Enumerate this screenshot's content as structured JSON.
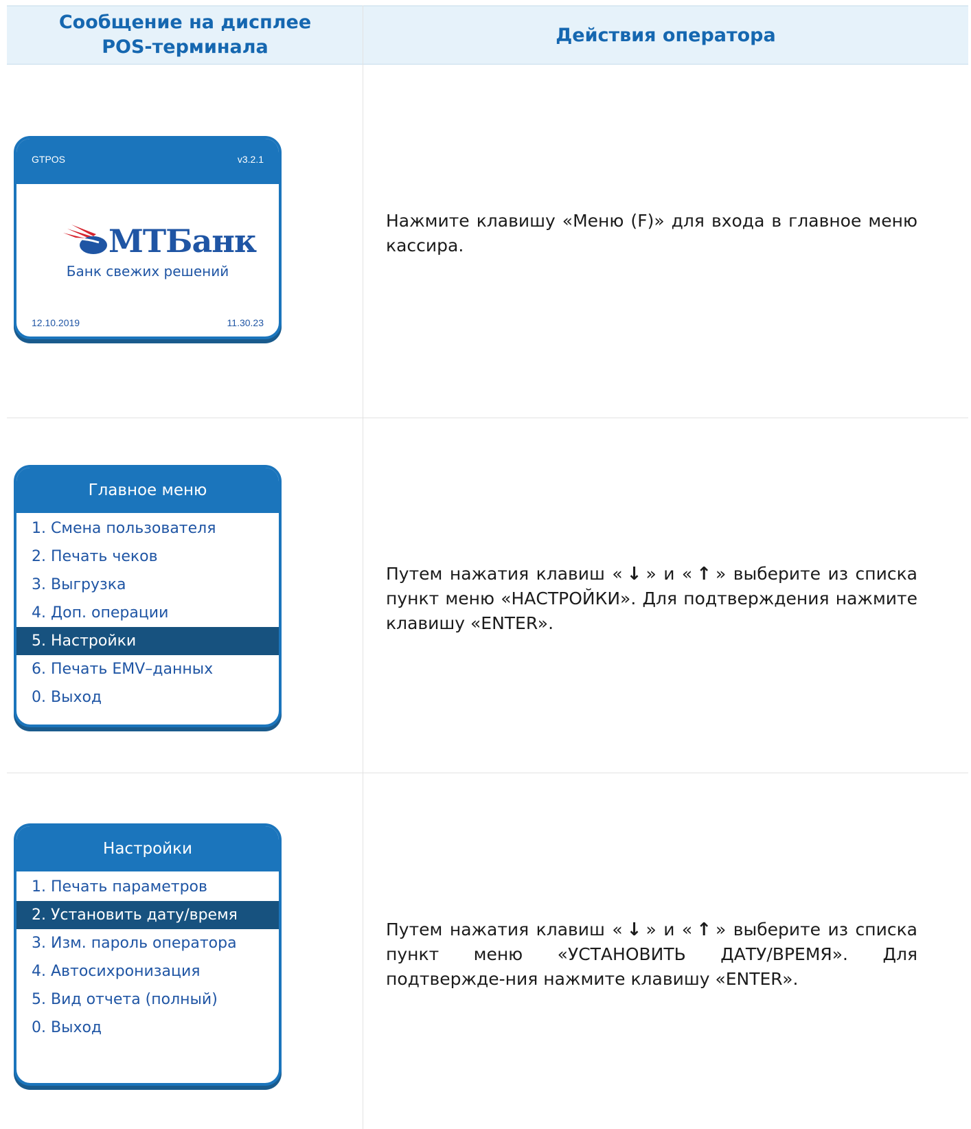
{
  "header": {
    "col1_line1": "Сообщение на дисплее",
    "col1_line2": "POS-терминала",
    "col2": "Действия оператора"
  },
  "screen1": {
    "app_name": "GTPOS",
    "version": "v3.2.1",
    "logo_text": "МТБанк",
    "slogan": "Банк свежих решений",
    "date": "12.10.2019",
    "time": "11.30.23"
  },
  "screen2": {
    "title": "Главное меню",
    "items": [
      "1. Смена пользователя",
      "2. Печать чеков",
      "3. Выгрузка",
      "4. Доп. операции",
      "5. Настройки",
      "6. Печать EMV–данных",
      "0. Выход"
    ]
  },
  "screen3": {
    "title": "Настройки",
    "items": [
      "1. Печать параметров",
      "2. Установить дату/время",
      "3. Изм. пароль оператора",
      "4. Автосихронизация",
      "5. Вид отчета (полный)",
      "0. Выход"
    ]
  },
  "actions": {
    "step1": "Нажмите клавишу «Меню (F)» для входа в главное меню кассира.",
    "step2_a": "Путем нажатия клавиш «",
    "step2_b": "» и «",
    "step2_c": "» выберите из списка пункт меню «НАСТРОЙКИ». Для подтверждения нажмите клавишу «ENTER».",
    "step3_a": "Путем нажатия  клавиш «",
    "step3_b": "» и «",
    "step3_c": "» выберите  из списка пункт меню «УСТАНОВИТЬ ДАТУ/ВРЕМЯ». Для подтвержде-ния нажмите клавишу «ENTER».",
    "arrow_down": "↓",
    "arrow_up": "↑"
  },
  "colors": {
    "primary": "#1b75bc",
    "selected": "#17527f",
    "header_bg": "#e6f2fa",
    "logo_red": "#d6252f"
  }
}
